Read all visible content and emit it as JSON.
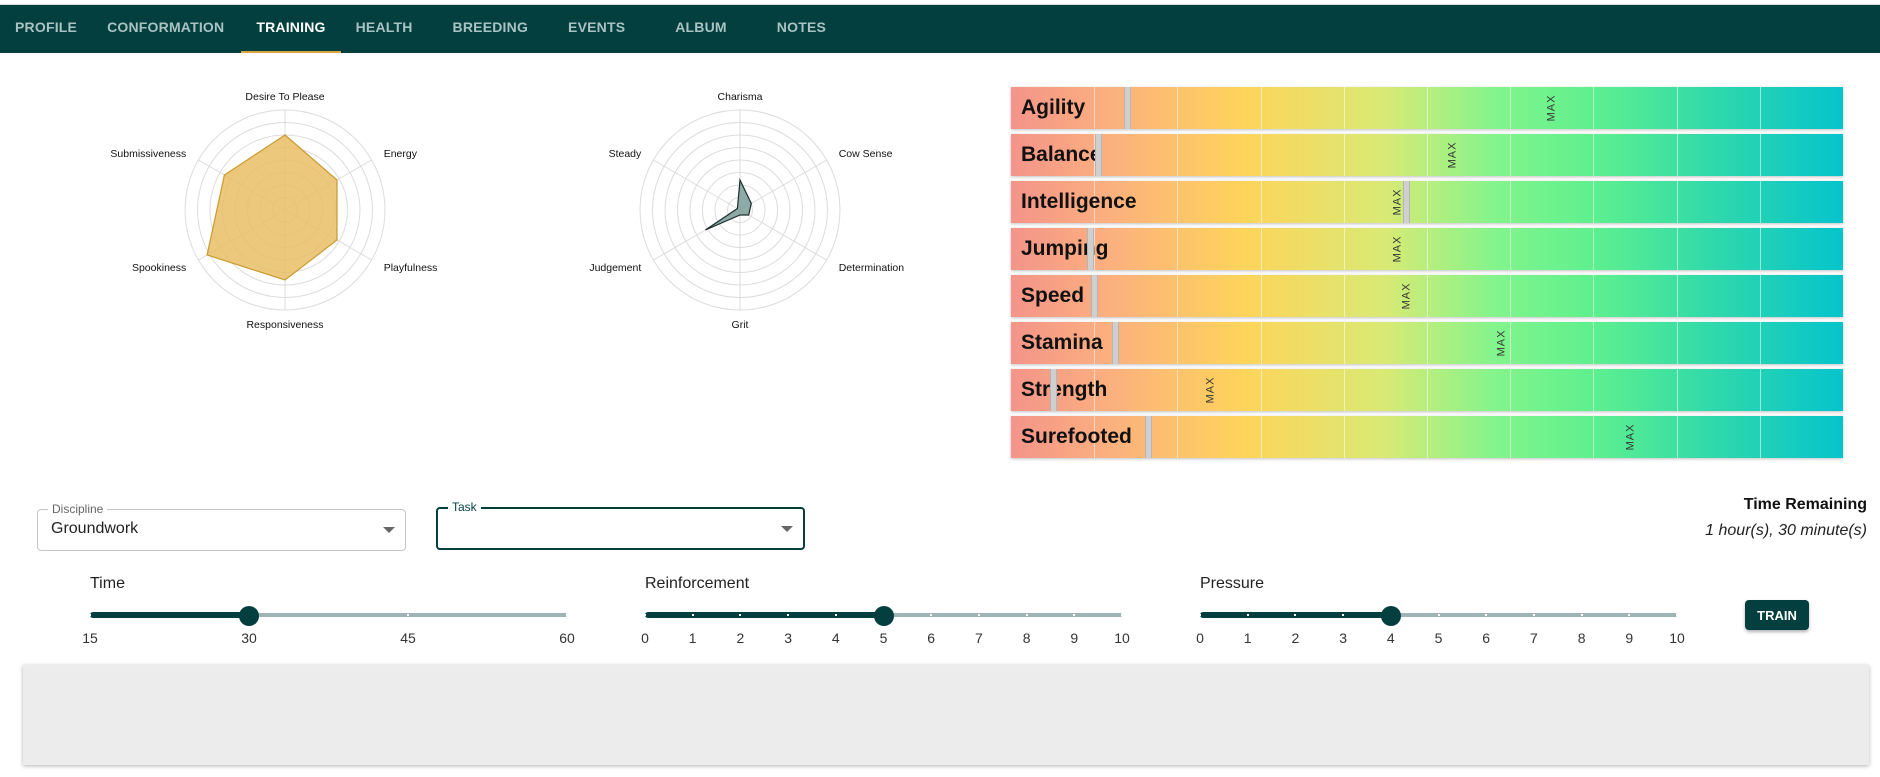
{
  "nav": {
    "tabs": [
      {
        "label": "PROFILE",
        "active": false
      },
      {
        "label": "CONFORMATION",
        "active": false
      },
      {
        "label": "TRAINING",
        "active": true
      },
      {
        "label": "HEALTH",
        "active": false
      },
      {
        "label": "BREEDING",
        "active": false
      },
      {
        "label": "EVENTS",
        "active": false
      },
      {
        "label": "ALBUM",
        "active": false
      },
      {
        "label": "NOTES",
        "active": false
      }
    ]
  },
  "chart_data": [
    {
      "type": "radar",
      "axes": [
        "Desire To Please",
        "Energy",
        "Playfulness",
        "Responsiveness",
        "Spookiness",
        "Submissiveness"
      ],
      "values": [
        7.5,
        6.0,
        6.0,
        7.0,
        9.0,
        7.0
      ],
      "max": 10,
      "rings": 8,
      "fill_color": "#e9be66",
      "stroke_color": "#c99a2e"
    },
    {
      "type": "radar",
      "axes": [
        "Charisma",
        "Cow Sense",
        "Determination",
        "Grit",
        "Judgement",
        "Steady"
      ],
      "values": [
        3.0,
        1.3,
        1.0,
        0.5,
        4.0,
        0.3
      ],
      "max": 10,
      "rings": 8,
      "fill_color": "#7a9c98",
      "stroke_color": "#1c2e2e"
    }
  ],
  "skills": [
    {
      "name": "Agility",
      "value": 0.14,
      "max": 0.65
    },
    {
      "name": "Balance",
      "value": 0.105,
      "max": 0.53
    },
    {
      "name": "Intelligence",
      "value": 0.475,
      "max": 0.465
    },
    {
      "name": "Jumping",
      "value": 0.095,
      "max": 0.465
    },
    {
      "name": "Speed",
      "value": 0.1,
      "max": 0.475
    },
    {
      "name": "Stamina",
      "value": 0.125,
      "max": 0.59
    },
    {
      "name": "Strength",
      "value": 0.05,
      "max": 0.24
    },
    {
      "name": "Surefooted",
      "value": 0.165,
      "max": 0.745
    }
  ],
  "skill_grid_lines": 10,
  "max_label": "MAX",
  "discipline": {
    "label": "Discipline",
    "value": "Groundwork"
  },
  "task": {
    "label": "Task",
    "value": ""
  },
  "time_remaining": {
    "title": "Time Remaining",
    "value": "1 hour(s), 30 minute(s)"
  },
  "sliders": {
    "time": {
      "title": "Time",
      "labels": [
        "15",
        "30",
        "45",
        "60"
      ],
      "min": 15,
      "max": 60,
      "step": 15,
      "value": 30
    },
    "reinforcement": {
      "title": "Reinforcement",
      "labels": [
        "0",
        "1",
        "2",
        "3",
        "4",
        "5",
        "6",
        "7",
        "8",
        "9",
        "10"
      ],
      "min": 0,
      "max": 10,
      "step": 1,
      "value": 5
    },
    "pressure": {
      "title": "Pressure",
      "labels": [
        "0",
        "1",
        "2",
        "3",
        "4",
        "5",
        "6",
        "7",
        "8",
        "9",
        "10"
      ],
      "min": 0,
      "max": 10,
      "step": 1,
      "value": 4
    }
  },
  "train_button": "TRAIN",
  "colors": {
    "primary": "#033f3f",
    "accent": "#d9a441",
    "output_bg": "#ececec"
  }
}
